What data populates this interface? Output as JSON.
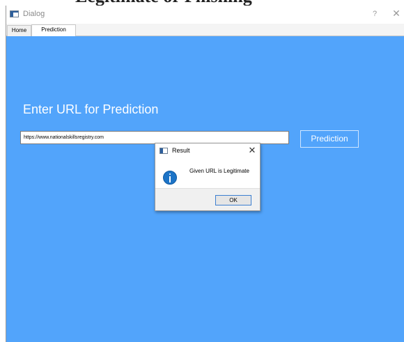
{
  "page": {
    "clipped_heading": "Legitimate or Phishing"
  },
  "window": {
    "title": "Dialog",
    "help_glyph": "?",
    "close_glyph": "✕",
    "icon": "app-window-icon"
  },
  "tabs": [
    {
      "label": "Home",
      "selected": false
    },
    {
      "label": "Prediction",
      "selected": true
    }
  ],
  "main": {
    "heading": "Enter URL for Prediction",
    "url_value": "https://www.nationalskillsregistry.com",
    "predict_label": "Prediction"
  },
  "dialog": {
    "title": "Result",
    "close_glyph": "✕",
    "message": "Given URL is Legitimate",
    "ok_label": "OK",
    "icon": "info-icon"
  },
  "colors": {
    "content_background": "#52a4fb",
    "info_icon": "#1d74c7",
    "ok_button_border": "#3c7fd1"
  }
}
